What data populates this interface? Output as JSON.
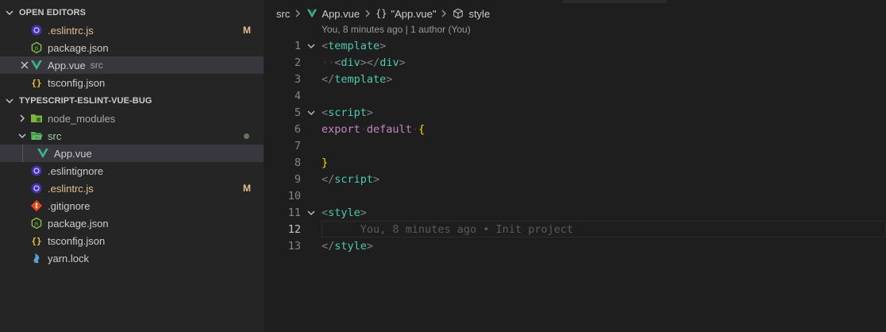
{
  "sidebar": {
    "open_editors": {
      "title": "OPEN EDITORS",
      "items": [
        {
          "name": ".eslintrc.js",
          "badge": "M"
        },
        {
          "name": "package.json"
        },
        {
          "name": "App.vue",
          "desc": "src"
        },
        {
          "name": "tsconfig.json"
        }
      ]
    },
    "workspace": {
      "title": "TYPESCRIPT-ESLINT-VUE-BUG",
      "items": [
        {
          "name": "node_modules"
        },
        {
          "name": "src"
        },
        {
          "name": "App.vue"
        },
        {
          "name": ".eslintignore"
        },
        {
          "name": ".eslintrc.js",
          "badge": "M"
        },
        {
          "name": ".gitignore"
        },
        {
          "name": "package.json"
        },
        {
          "name": "tsconfig.json"
        },
        {
          "name": "yarn.lock"
        }
      ]
    }
  },
  "editor": {
    "breadcrumb": {
      "src": "src",
      "file": "App.vue",
      "symbol": "\"App.vue\"",
      "section": "style"
    },
    "codelens": "You, 8 minutes ago | 1 author (You)",
    "blame": "You, 8 minutes ago • Init project",
    "line_numbers": [
      "1",
      "2",
      "3",
      "4",
      "5",
      "6",
      "7",
      "8",
      "9",
      "10",
      "11",
      "12",
      "13"
    ]
  },
  "colors": {
    "sidebar_bg": "#252526",
    "editor_bg": "#1e1e1e",
    "modified": "#e2c08d",
    "vue_green": "#41b883",
    "tag": "#4ec9b0",
    "keyword": "#c586c0",
    "brace": "#ffd700"
  }
}
